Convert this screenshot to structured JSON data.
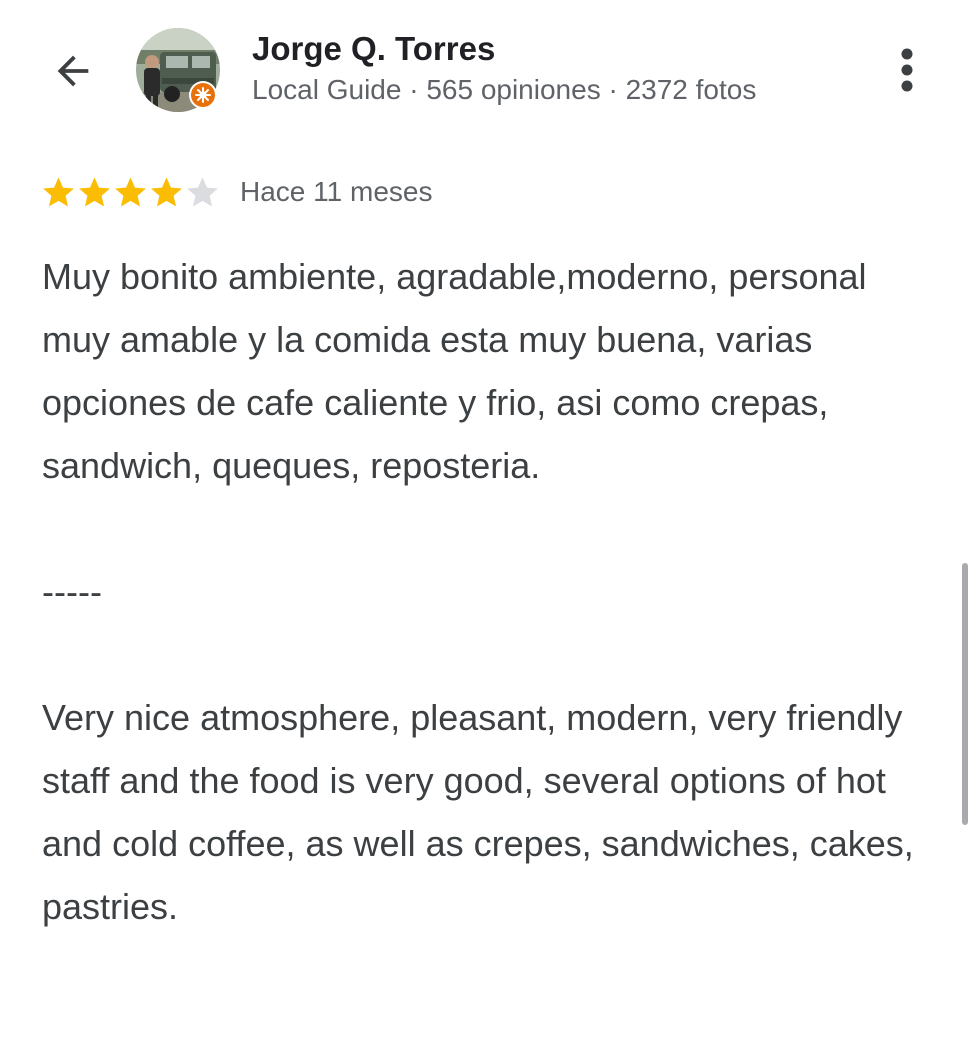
{
  "header": {
    "back_icon": "arrow-left-icon",
    "reviewer_name": "Jorge Q. Torres",
    "reviewer_meta": "Local Guide · 565 opiniones · 2372 fotos",
    "badge_icon": "local-guide-badge-icon",
    "badge_color": "#e8710a",
    "menu_icon": "more-vert-icon"
  },
  "review": {
    "rating": 4,
    "max_rating": 5,
    "star_color": "#fbbc04",
    "empty_star_color": "#dadce0",
    "date": "Hace 11 meses",
    "paragraphs": [
      "Muy bonito ambiente, agradable,moderno, personal muy amable y la comida esta muy buena, varias opciones de cafe caliente y frio, asi como crepas, sandwich, queques, reposteria.",
      "-----",
      "Very nice atmosphere, pleasant, modern, very friendly staff and the food is very good, several options of hot and cold coffee, as well as crepes, sandwiches, cakes, pastries."
    ]
  }
}
